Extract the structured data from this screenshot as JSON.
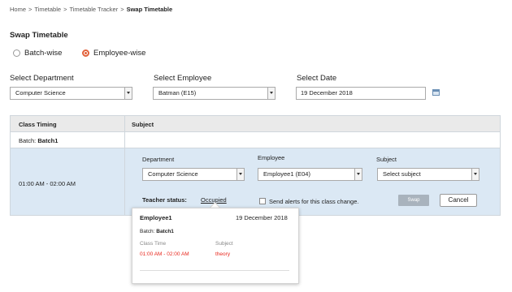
{
  "breadcrumb": {
    "items": [
      "Home",
      "Timetable",
      "Timetable Tracker"
    ],
    "current": "Swap Timetable",
    "separator": ">"
  },
  "page": {
    "title": "Swap Timetable",
    "mode_options": [
      {
        "label": "Batch-wise",
        "selected": false
      },
      {
        "label": "Employee-wise",
        "selected": true
      }
    ]
  },
  "filters": {
    "department_label": "Select Department",
    "department_value": "Computer Science",
    "employee_label": "Select Employee",
    "employee_value": "Batman (E15)",
    "date_label": "Select Date",
    "date_value": "19 December 2018"
  },
  "table": {
    "headers": [
      "Class Timing",
      "Subject"
    ],
    "batch_prefix": "Batch:",
    "batch_name": "Batch1",
    "class_timing": "01:00 AM - 02:00 AM",
    "swap_form": {
      "department_label": "Department",
      "department_value": "Computer Science",
      "employee_label": "Employee",
      "employee_value": "Employee1 (E04)",
      "subject_label": "Subject",
      "subject_placeholder": "Select subject",
      "teacher_status_label": "Teacher status:",
      "teacher_status_value": "Occupied",
      "send_alerts_label": "Send alerts for this class change.",
      "swap_button": "Swap",
      "cancel_button": "Cancel"
    }
  },
  "popup": {
    "employee": "Employee1",
    "date": "19 December 2018",
    "batch_prefix": "Batch:",
    "batch_name": "Batch1",
    "col_class_time": "Class Time",
    "col_subject": "Subject",
    "class_time": "01:00 AM - 02:00 AM",
    "subject": "theory"
  },
  "colors": {
    "accent_radio": "#e2623b",
    "swap_row_bg": "#dbe8f4",
    "header_bg": "#eaeaea",
    "occupied_red": "#e8281e"
  }
}
